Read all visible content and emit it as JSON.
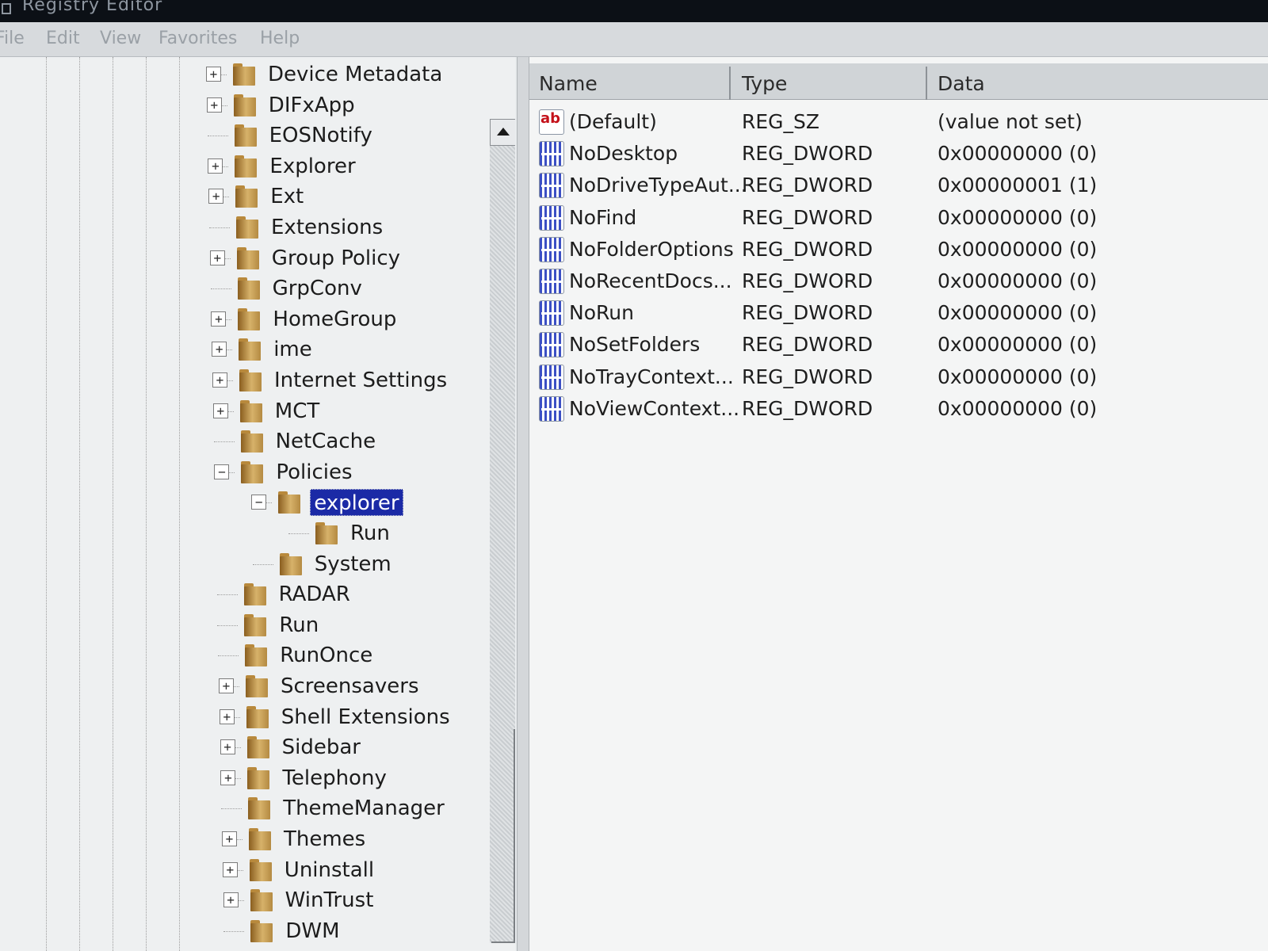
{
  "window": {
    "title": "Registry Editor"
  },
  "menu": [
    "File",
    "Edit",
    "View",
    "Favorites",
    "Help"
  ],
  "tree": {
    "items": [
      {
        "label": "Device Metadata",
        "expander": "+"
      },
      {
        "label": "DIFxApp",
        "expander": "+"
      },
      {
        "label": "EOSNotify",
        "expander": ""
      },
      {
        "label": "Explorer",
        "expander": "+"
      },
      {
        "label": "Ext",
        "expander": "+"
      },
      {
        "label": "Extensions",
        "expander": ""
      },
      {
        "label": "Group Policy",
        "expander": "+"
      },
      {
        "label": "GrpConv",
        "expander": ""
      },
      {
        "label": "HomeGroup",
        "expander": "+"
      },
      {
        "label": "ime",
        "expander": "+"
      },
      {
        "label": "Internet Settings",
        "expander": "+"
      },
      {
        "label": "MCT",
        "expander": "+"
      },
      {
        "label": "NetCache",
        "expander": ""
      },
      {
        "label": "Policies",
        "expander": "−"
      },
      {
        "label": "explorer",
        "expander": "−",
        "selected": true
      },
      {
        "label": "Run",
        "expander": ""
      },
      {
        "label": "System",
        "expander": ""
      },
      {
        "label": "RADAR",
        "expander": ""
      },
      {
        "label": "Run",
        "expander": ""
      },
      {
        "label": "RunOnce",
        "expander": ""
      },
      {
        "label": "Screensavers",
        "expander": "+"
      },
      {
        "label": "Shell Extensions",
        "expander": "+"
      },
      {
        "label": "Sidebar",
        "expander": "+"
      },
      {
        "label": "Telephony",
        "expander": "+"
      },
      {
        "label": "ThemeManager",
        "expander": ""
      },
      {
        "label": "Themes",
        "expander": "+"
      },
      {
        "label": "Uninstall",
        "expander": "+"
      },
      {
        "label": "WinTrust",
        "expander": "+"
      },
      {
        "label": "DWM",
        "expander": ""
      }
    ]
  },
  "list": {
    "columns": [
      "Name",
      "Type",
      "Data"
    ],
    "rows": [
      {
        "icon": "string-value-icon",
        "name": "(Default)",
        "type": "REG_SZ",
        "data": "(value not set)"
      },
      {
        "icon": "binary-value-icon",
        "name": "NoDesktop",
        "type": "REG_DWORD",
        "data": "0x00000000 (0)"
      },
      {
        "icon": "binary-value-icon",
        "name": "NoDriveTypeAut...",
        "type": "REG_DWORD",
        "data": "0x00000001 (1)"
      },
      {
        "icon": "binary-value-icon",
        "name": "NoFind",
        "type": "REG_DWORD",
        "data": "0x00000000 (0)"
      },
      {
        "icon": "binary-value-icon",
        "name": "NoFolderOptions",
        "type": "REG_DWORD",
        "data": "0x00000000 (0)"
      },
      {
        "icon": "binary-value-icon",
        "name": "NoRecentDocs...",
        "type": "REG_DWORD",
        "data": "0x00000000 (0)"
      },
      {
        "icon": "binary-value-icon",
        "name": "NoRun",
        "type": "REG_DWORD",
        "data": "0x00000000 (0)"
      },
      {
        "icon": "binary-value-icon",
        "name": "NoSetFolders",
        "type": "REG_DWORD",
        "data": "0x00000000 (0)"
      },
      {
        "icon": "binary-value-icon",
        "name": "NoTrayContext...",
        "type": "REG_DWORD",
        "data": "0x00000000 (0)"
      },
      {
        "icon": "binary-value-icon",
        "name": "NoViewContext...",
        "type": "REG_DWORD",
        "data": "0x00000000 (0)"
      }
    ]
  },
  "colors": {
    "selection": "#1b2aa6",
    "folder": "#c49a4e",
    "dword_icon": "#3b4fc4",
    "sz_icon": "#c4111a"
  }
}
